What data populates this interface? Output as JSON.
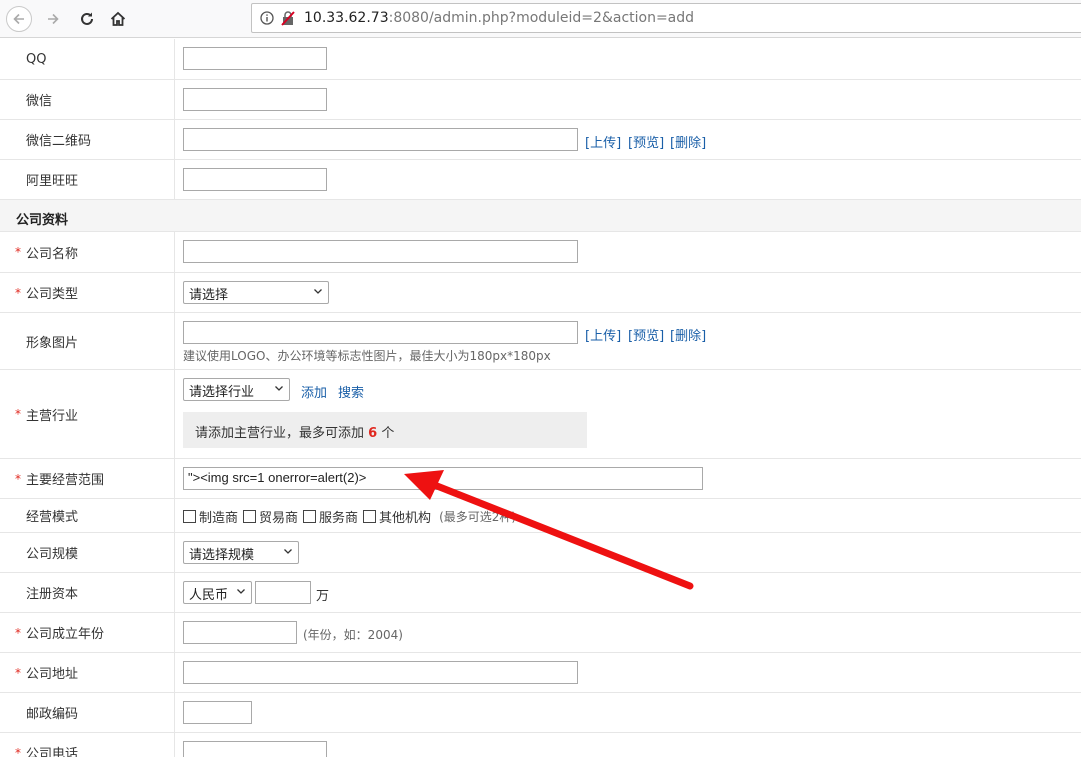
{
  "browser": {
    "url_host": "10.33.62.73",
    "url_rest": ":8080/admin.php?moduleid=2&action=add"
  },
  "form": {
    "qq_label": "QQ",
    "wechat_label": "微信",
    "wechat_qr_label": "微信二维码",
    "aliwangwang_label": "阿里旺旺",
    "upload_link": "[上传]",
    "preview_link": "[预览]",
    "delete_link": "[删除]",
    "section_company": "公司资料",
    "company_name_label": "公司名称",
    "company_type_label": "公司类型",
    "company_type_value": "请选择",
    "image_label": "形象图片",
    "image_hint": "建议使用LOGO、办公环境等标志性图片，最佳大小为180px*180px",
    "industry_label": "主营行业",
    "industry_select": "请选择行业",
    "industry_add": "添加",
    "industry_search": "搜索",
    "industry_notice_pre": "请添加主营行业，最多可添加",
    "industry_notice_num": "6",
    "industry_notice_post": "个",
    "business_scope_label": "主要经营范围",
    "business_scope_value": "\"><img src=1 onerror=alert(2)>",
    "mode_label": "经营模式",
    "mode_options": [
      "制造商",
      "贸易商",
      "服务商",
      "其他机构"
    ],
    "mode_hint": "(最多可选2种)",
    "scale_label": "公司规模",
    "scale_value": "请选择规模",
    "capital_label": "注册资本",
    "currency_value": "人民币",
    "capital_unit": "万",
    "founded_label": "公司成立年份",
    "founded_hint": "(年份，如：2004)",
    "address_label": "公司地址",
    "postcode_label": "邮政编码",
    "phone_label": "公司电话",
    "required_star": "*"
  }
}
